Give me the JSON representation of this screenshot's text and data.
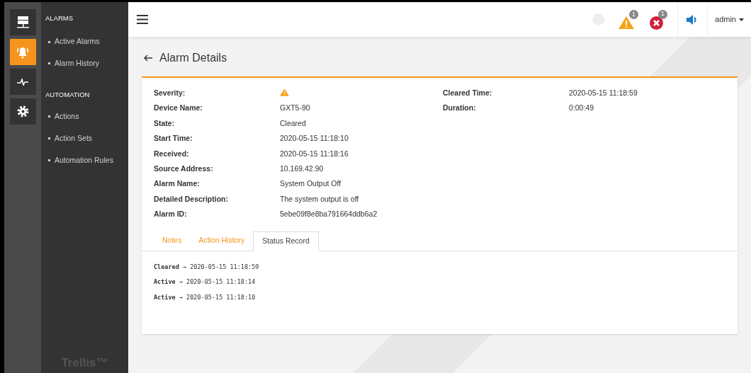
{
  "rail": [
    {
      "selected": false
    },
    {
      "selected": true
    },
    {
      "selected": false
    },
    {
      "selected": false
    }
  ],
  "menu": [
    {
      "heading": "ALARMS",
      "items": [
        "Active Alarms",
        "Alarm History"
      ]
    },
    {
      "heading": "AUTOMATION",
      "items": [
        "Actions",
        "Action Sets",
        "Automation Rules"
      ]
    }
  ],
  "brand": "Trellis™",
  "header": {
    "warning_count": "1",
    "error_count": "1",
    "user": "admin"
  },
  "page_title": "Alarm Details",
  "details_left": [
    {
      "kind": "icon",
      "label": "Severity:"
    },
    {
      "kind": "text",
      "label": "Device Name:",
      "value": "GXT5-90"
    },
    {
      "kind": "text",
      "label": "State:",
      "value": "Cleared"
    },
    {
      "kind": "text",
      "label": "Start Time:",
      "value": "2020-05-15 11:18:10"
    },
    {
      "kind": "text",
      "label": "Received:",
      "value": "2020-05-15 11:18:16"
    },
    {
      "kind": "text",
      "label": "Source Address:",
      "value": "10.169.42.90"
    },
    {
      "kind": "text",
      "label": "Alarm Name:",
      "value": "System Output Off"
    },
    {
      "kind": "text",
      "label": "Detailed Description:",
      "value": "The system output is off"
    },
    {
      "kind": "text",
      "label": "Alarm ID:",
      "value": "5ebe09f8e8ba791664ddb6a2"
    }
  ],
  "details_right": [
    {
      "kind": "text",
      "label": "Cleared Time:",
      "value": "2020-05-15 11:18:59"
    },
    {
      "kind": "text",
      "label": "Duration:",
      "value": "0:00:49"
    }
  ],
  "tabs": [
    {
      "label": "Notes",
      "selected": false
    },
    {
      "label": "Action History",
      "selected": false
    },
    {
      "label": "Status Record",
      "selected": true
    }
  ],
  "status_record": [
    "**Cleared** → 2020-05-15 11:18:59",
    "**Active** → 2020-05-15 11:18:14",
    "**Active** → 2020-05-15 11:18:10"
  ]
}
